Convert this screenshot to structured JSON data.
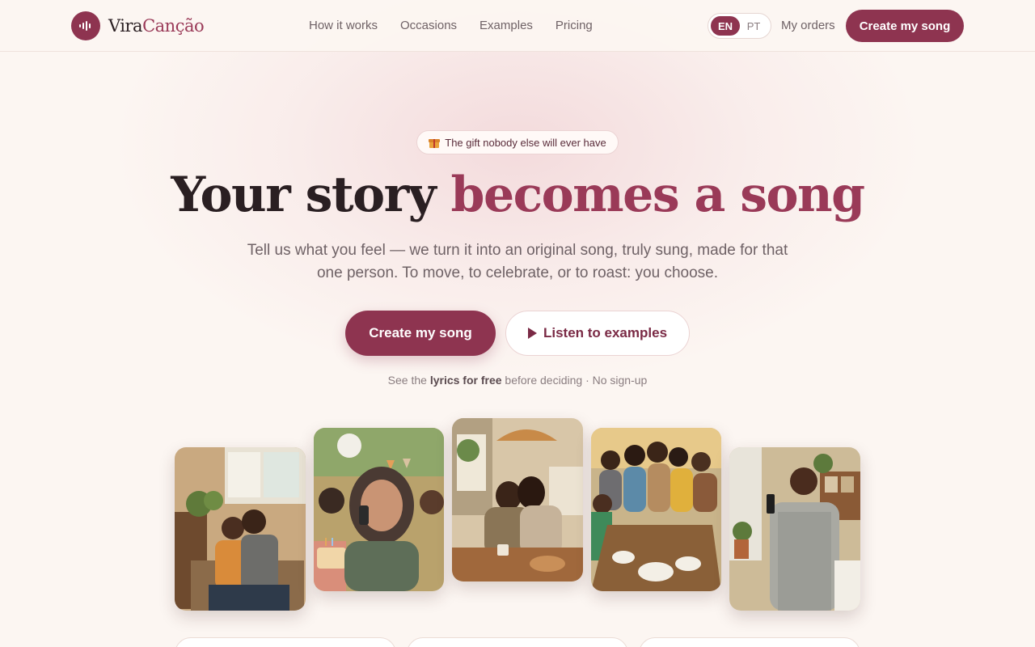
{
  "brand": {
    "part1": "Vira",
    "part2": "Canção",
    "logo_icon": "sound-wave-icon"
  },
  "nav": {
    "items": [
      "How it works",
      "Occasions",
      "Examples",
      "Pricing"
    ]
  },
  "lang": {
    "active": "EN",
    "inactive": "PT"
  },
  "header": {
    "my_orders": "My orders",
    "cta": "Create my song"
  },
  "hero": {
    "pill": "The gift nobody else will ever have",
    "pill_icon": "gift-icon",
    "title_plain": "Your story ",
    "title_accent": "becomes a song",
    "subtitle": "Tell us what you feel — we turn it into an original song, truly sung, made for that one person. To move, to celebrate, or to roast: you choose.",
    "cta_primary": "Create my song",
    "cta_secondary": "Listen to examples",
    "note_pre": "See the ",
    "note_bold": "lyrics for free",
    "note_post": " before deciding · No sign-up"
  },
  "photos": [
    {
      "name": "photo-couple-listening"
    },
    {
      "name": "photo-woman-crying-phone"
    },
    {
      "name": "photo-friends-hugging-kitchen"
    },
    {
      "name": "photo-family-dinner"
    },
    {
      "name": "photo-man-listening-phone"
    }
  ],
  "colors": {
    "accent": "#8e3450",
    "accent_text": "#9a3a58",
    "background": "#fcf6f2"
  }
}
